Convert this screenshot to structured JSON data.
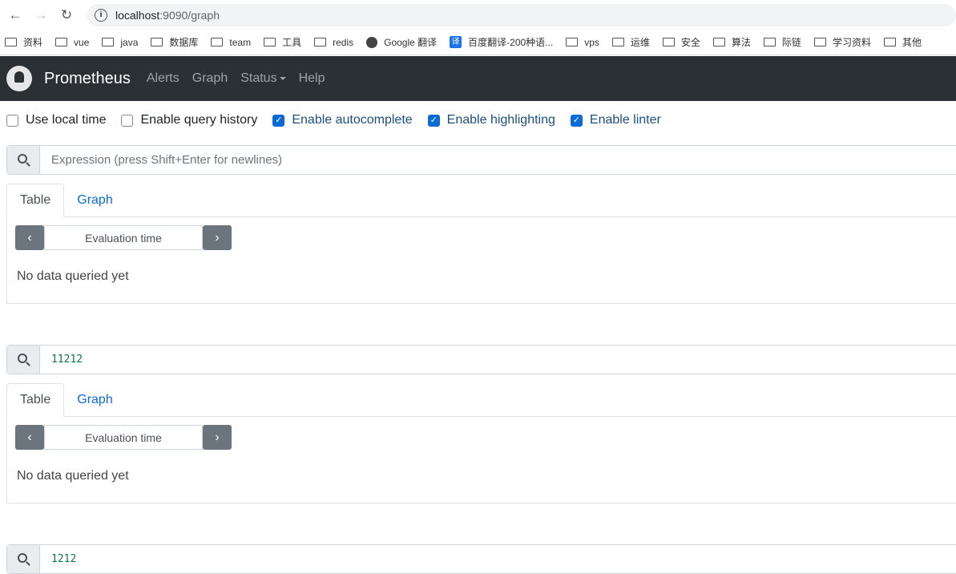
{
  "browser": {
    "url_host": "localhost",
    "url_rest": ":9090/graph"
  },
  "bookmarks": [
    {
      "label": "资料",
      "icon": "folder"
    },
    {
      "label": "vue",
      "icon": "folder"
    },
    {
      "label": "java",
      "icon": "folder"
    },
    {
      "label": "数据库",
      "icon": "folder"
    },
    {
      "label": "team",
      "icon": "folder"
    },
    {
      "label": "工具",
      "icon": "folder"
    },
    {
      "label": "redis",
      "icon": "folder"
    },
    {
      "label": "Google 翻译",
      "icon": "globe"
    },
    {
      "label": "百度翻译-200种语...",
      "icon": "translate"
    },
    {
      "label": "vps",
      "icon": "folder"
    },
    {
      "label": "运维",
      "icon": "folder"
    },
    {
      "label": "安全",
      "icon": "folder"
    },
    {
      "label": "算法",
      "icon": "folder"
    },
    {
      "label": "际链",
      "icon": "folder"
    },
    {
      "label": "学习资料",
      "icon": "folder"
    },
    {
      "label": "其他",
      "icon": "folder"
    }
  ],
  "nav": {
    "brand": "Prometheus",
    "links": [
      "Alerts",
      "Graph",
      "Status",
      "Help"
    ]
  },
  "options": [
    {
      "label": "Use local time",
      "checked": false
    },
    {
      "label": "Enable query history",
      "checked": false
    },
    {
      "label": "Enable autocomplete",
      "checked": true
    },
    {
      "label": "Enable highlighting",
      "checked": true
    },
    {
      "label": "Enable linter",
      "checked": true
    }
  ],
  "panels": [
    {
      "expression": "",
      "placeholder": "Expression (press Shift+Enter for newlines)",
      "tabs": [
        "Table",
        "Graph"
      ],
      "eval_label": "Evaluation time",
      "empty": "No data queried yet"
    },
    {
      "expression": "11212",
      "tabs": [
        "Table",
        "Graph"
      ],
      "eval_label": "Evaluation time",
      "empty": "No data queried yet"
    },
    {
      "expression": "1212"
    }
  ],
  "colors": {
    "navbar": "#2b3035",
    "accent": "#0b6bd6"
  }
}
